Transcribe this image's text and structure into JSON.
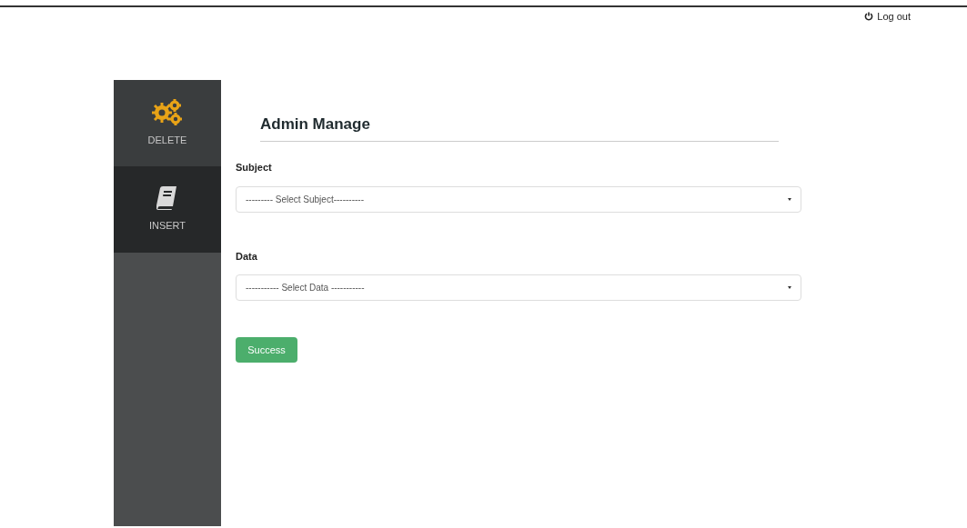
{
  "header": {
    "logout": "Log out"
  },
  "sidebar": {
    "items": [
      {
        "label": "DELETE",
        "kind": "gears",
        "selected": false
      },
      {
        "label": "INSERT",
        "kind": "book",
        "selected": true
      }
    ]
  },
  "main": {
    "title": "Admin Manage",
    "fields": [
      {
        "label": "Subject",
        "placeholder": "--------- Select Subject----------"
      },
      {
        "label": "Data",
        "placeholder": "----------- Select Data -----------"
      }
    ],
    "button": "Success"
  }
}
